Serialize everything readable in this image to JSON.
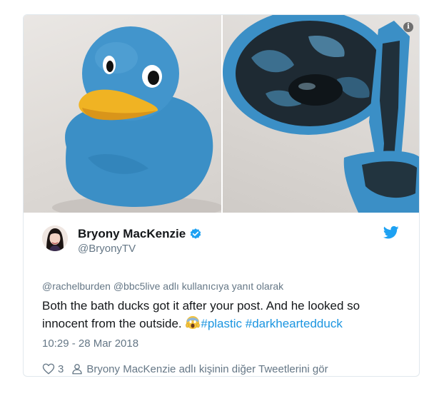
{
  "media": {
    "info_glyph": "i",
    "left_photo_icon": "rubber-duck-photo",
    "right_photo_icon": "cut-open-duck-photo"
  },
  "author": {
    "name": "Bryony MacKenzie",
    "handle": "@BryonyTV",
    "verified_icon": "verified-badge-icon",
    "brand_icon": "twitter-bird-icon"
  },
  "tweet": {
    "reply_to": "@rachelburden @bbc5live adlı kullanıcıya yanıt olarak",
    "text_line1": "Both the bath ducks got it after your post. And he looked so",
    "text_line2": "innocent from the outside.",
    "emoji_icon": "screaming-face-emoji",
    "hashtags": [
      "#plastic",
      "#darkheartedduck"
    ],
    "timestamp": "10:29 - 28 Mar 2018"
  },
  "actions": {
    "likes": "3",
    "more_tweets": "Bryony MacKenzie adlı kişinin diğer Tweetlerini gör"
  },
  "colors": {
    "link": "#1b95e0",
    "muted": "#657786",
    "text": "#14171a",
    "border": "#e1e8ed",
    "duck_blue": "#3b8fc6"
  }
}
